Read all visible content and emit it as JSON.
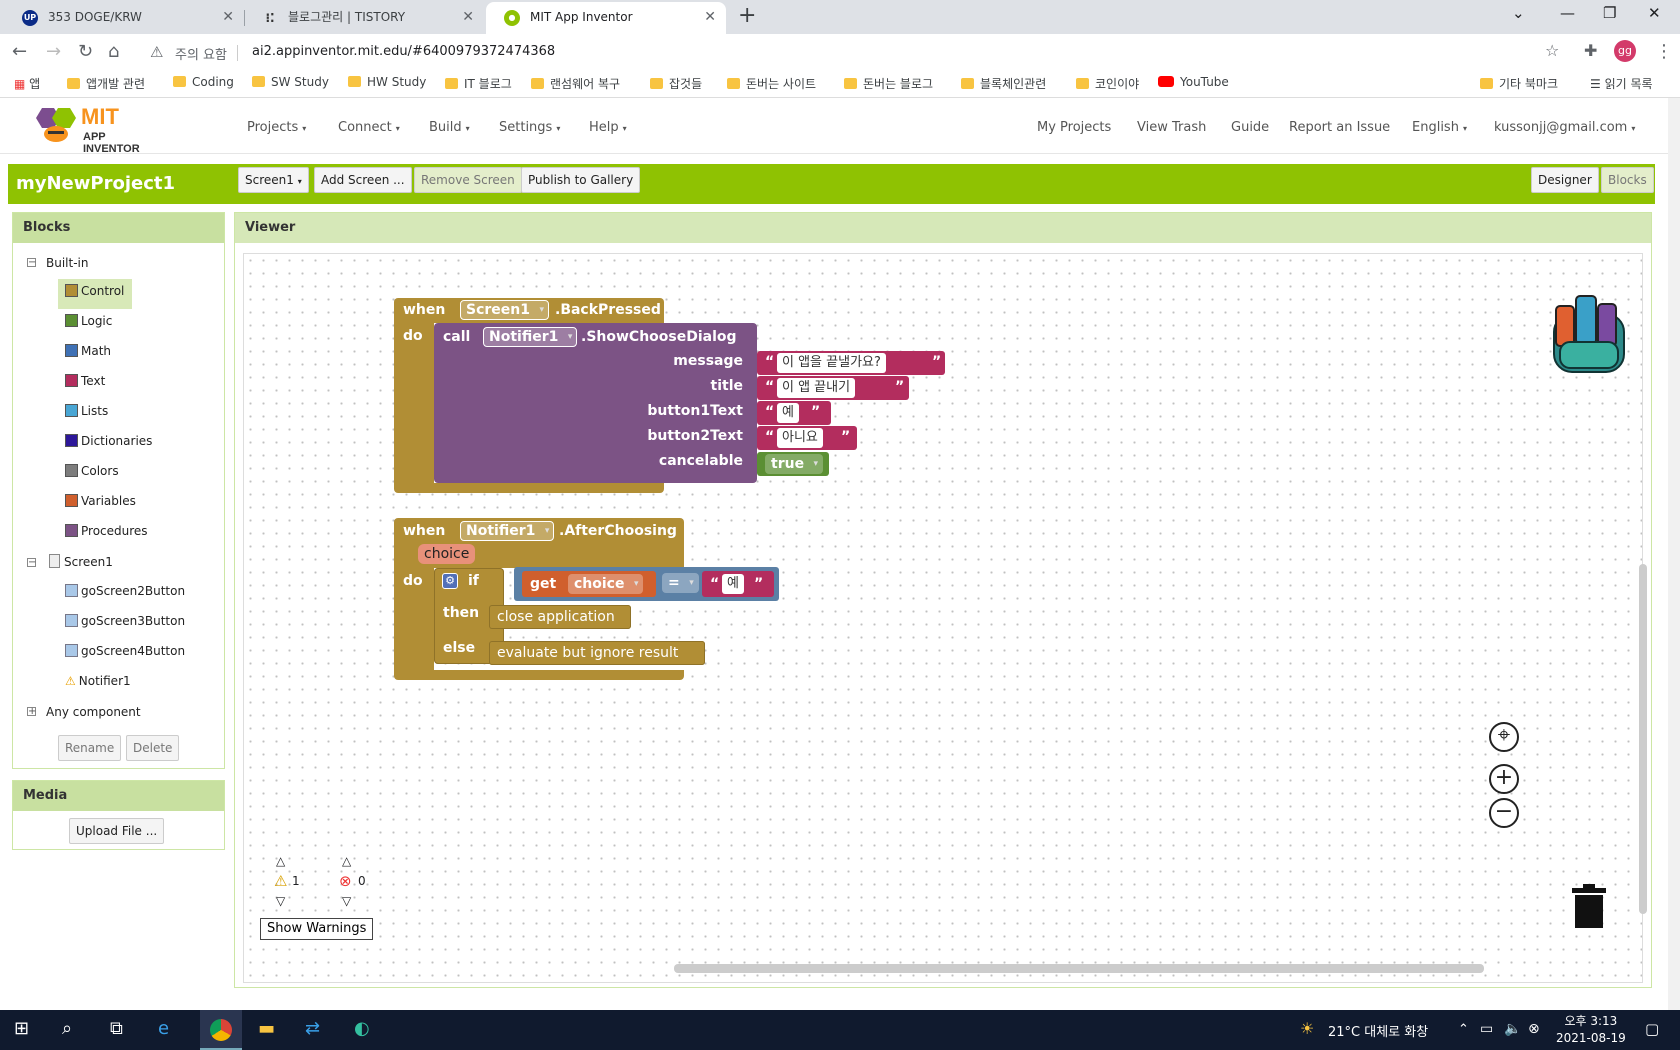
{
  "browser": {
    "tabs": [
      {
        "title": "353 DOGE/KRW",
        "icon": "upbit-icon"
      },
      {
        "title": "블로그관리 | TISTORY",
        "icon": "tistory-icon"
      },
      {
        "title": "MIT App Inventor",
        "icon": "appinventor-icon"
      }
    ],
    "url_warning": "주의 요함",
    "url": "ai2.appinventor.mit.edu/#6400979372474368",
    "bookmarks": [
      "앱",
      "앱개발 관련",
      "Coding",
      "SW Study",
      "HW Study",
      "IT 블로그",
      "랜섬웨어 복구",
      "잡것들",
      "돈버는 사이트",
      "돈버는 블로그",
      "블록체인관련",
      "코인이야",
      "YouTube",
      "기타 북마크",
      "읽기 목록"
    ],
    "profile_initials": "gg"
  },
  "app": {
    "logo_mit": "MIT",
    "logo_sub": "APP INVENTOR",
    "menu": [
      "Projects",
      "Connect",
      "Build",
      "Settings",
      "Help"
    ],
    "right_menu": [
      "My Projects",
      "View Trash",
      "Guide",
      "Report an Issue",
      "English",
      "kussonjj@gmail.com"
    ],
    "project_name": "myNewProject1",
    "screen_select": "Screen1",
    "add_screen": "Add Screen ...",
    "remove_screen": "Remove Screen",
    "publish": "Publish to Gallery",
    "designer": "Designer",
    "blocks_btn": "Blocks"
  },
  "blocks_panel": {
    "title": "Blocks",
    "builtin": "Built-in",
    "items": [
      {
        "label": "Control",
        "color": "#b18e35"
      },
      {
        "label": "Logic",
        "color": "#5b8f33"
      },
      {
        "label": "Math",
        "color": "#3f71b5"
      },
      {
        "label": "Text",
        "color": "#b32d5e"
      },
      {
        "label": "Lists",
        "color": "#49a6d4"
      },
      {
        "label": "Dictionaries",
        "color": "#2d1799"
      },
      {
        "label": "Colors",
        "color": "#7d7d7d"
      },
      {
        "label": "Variables",
        "color": "#d05f2d"
      },
      {
        "label": "Procedures",
        "color": "#7c5385"
      }
    ],
    "screen": "Screen1",
    "components": [
      "goScreen2Button",
      "goScreen3Button",
      "goScreen4Button",
      "Notifier1"
    ],
    "any_component": "Any component",
    "rename": "Rename",
    "delete": "Delete"
  },
  "media_panel": {
    "title": "Media",
    "upload": "Upload File ..."
  },
  "viewer": {
    "title": "Viewer",
    "block1": {
      "when": "when",
      "component": "Screen1",
      "event": ".BackPressed",
      "do": "do",
      "call": "call",
      "notifier": "Notifier1",
      "method": ".ShowChooseDialog",
      "args": [
        {
          "name": "message",
          "value": "이 앱을 끝낼가요?"
        },
        {
          "name": "title",
          "value": "이 앱 끝내기"
        },
        {
          "name": "button1Text",
          "value": "예"
        },
        {
          "name": "button2Text",
          "value": "아니요"
        }
      ],
      "cancelable_label": "cancelable",
      "cancelable_value": "true"
    },
    "block2": {
      "when": "when",
      "component": "Notifier1",
      "event": ".AfterChoosing",
      "param": "choice",
      "do": "do",
      "if": "if",
      "get": "get",
      "var": "choice",
      "op": "=",
      "compare": "예",
      "then": "then",
      "then_block": "close application",
      "else": "else",
      "else_block": "evaluate but ignore result"
    },
    "warnings_count": "1",
    "errors_count": "0",
    "show_warnings": "Show Warnings"
  },
  "taskbar": {
    "weather": "21°C 대체로 화창",
    "time": "오후 3:13",
    "date": "2021-08-19"
  }
}
